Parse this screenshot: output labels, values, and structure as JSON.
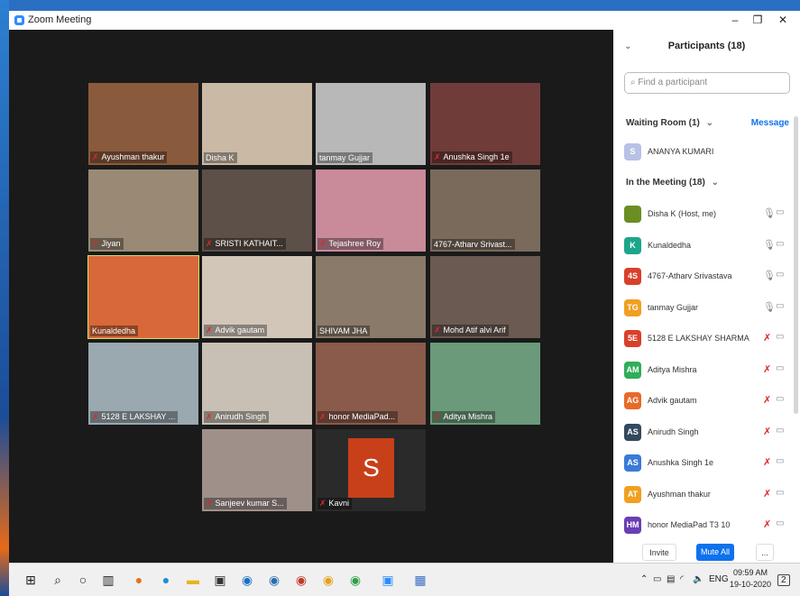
{
  "window": {
    "title": "Zoom Meeting",
    "minimize": "–",
    "restore": "❐",
    "close": "✕"
  },
  "tiles": [
    {
      "name": "Ayushman thakur",
      "muted": true
    },
    {
      "name": "Disha K",
      "muted": false
    },
    {
      "name": "tanmay Gujjar",
      "muted": false
    },
    {
      "name": "Anushka Singh 1e",
      "muted": true
    },
    {
      "name": "Jiyan",
      "muted": true
    },
    {
      "name": "SRISTI KATHAIT...",
      "muted": true
    },
    {
      "name": "Tejashree Roy",
      "muted": true
    },
    {
      "name": "4767-Atharv Srivast...",
      "muted": false
    },
    {
      "name": "Kunaldedha",
      "muted": false
    },
    {
      "name": "Advik gautam",
      "muted": true
    },
    {
      "name": "SHIVAM JHA",
      "muted": false
    },
    {
      "name": "Mohd Atif alvi Arif",
      "muted": true
    },
    {
      "name": "5128 E LAKSHAY ...",
      "muted": true
    },
    {
      "name": "Anirudh Singh",
      "muted": true
    },
    {
      "name": "honor MediaPad...",
      "muted": true
    },
    {
      "name": "Aditya Mishra",
      "muted": true
    },
    {
      "name": "Sanjeev kumar S...",
      "muted": true
    },
    {
      "name": "Kavni",
      "muted": true,
      "avatar_letter": "S"
    }
  ],
  "panel": {
    "title": "Participants (18)",
    "search_placeholder": "Find a participant",
    "waiting_label": "Waiting Room (1)",
    "message_label": "Message",
    "waiting": [
      {
        "initials": "S",
        "name": "ANANYA KUMARI",
        "color": "#b9c1e6"
      }
    ],
    "meeting_label": "In the Meeting (18)",
    "participants": [
      {
        "initials": "",
        "name": "Disha K (Host, me)",
        "color": "#6b8e23",
        "muted": false
      },
      {
        "initials": "K",
        "name": "Kunaldedha",
        "color": "#1ca68a",
        "muted": false
      },
      {
        "initials": "4S",
        "name": "4767-Atharv Srivastava",
        "color": "#d9402b",
        "muted": false
      },
      {
        "initials": "TG",
        "name": "tanmay Gujjar",
        "color": "#f0a020",
        "muted": false
      },
      {
        "initials": "5E",
        "name": "5128 E LAKSHAY SHARMA",
        "color": "#d9402b",
        "muted": true
      },
      {
        "initials": "AM",
        "name": "Aditya Mishra",
        "color": "#2fae5a",
        "muted": true
      },
      {
        "initials": "AG",
        "name": "Advik gautam",
        "color": "#e86a28",
        "muted": true
      },
      {
        "initials": "AS",
        "name": "Anirudh Singh",
        "color": "#34495e",
        "muted": true
      },
      {
        "initials": "AS",
        "name": "Anushka Singh 1e",
        "color": "#3a7bd5",
        "muted": true
      },
      {
        "initials": "AT",
        "name": "Ayushman thakur",
        "color": "#f0a020",
        "muted": true
      },
      {
        "initials": "HM",
        "name": "honor MediaPad T3 10",
        "color": "#6a3fb5",
        "muted": true
      }
    ],
    "invite": "Invite",
    "mute_all": "Mute All",
    "more": "..."
  },
  "taskbar": {
    "time": "09:59 AM",
    "date": "19-10-2020",
    "lang": "ENG",
    "notifications": "2"
  }
}
